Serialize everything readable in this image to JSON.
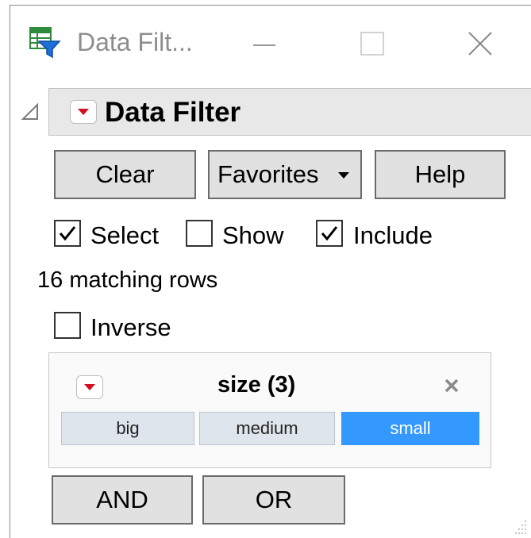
{
  "window": {
    "title": "Data Filt...",
    "controls": [
      "minimize-icon",
      "maximize-icon",
      "close-icon"
    ]
  },
  "panel": {
    "title": "Data Filter",
    "buttons": {
      "clear": "Clear",
      "favorites": "Favorites",
      "help": "Help",
      "and": "AND",
      "or": "OR"
    },
    "options": {
      "select": {
        "label": "Select",
        "checked": true
      },
      "show": {
        "label": "Show",
        "checked": false
      },
      "include": {
        "label": "Include",
        "checked": true
      },
      "inverse": {
        "label": "Inverse",
        "checked": false
      }
    },
    "status": "16 matching rows"
  },
  "filter": {
    "column": "size (3)",
    "levels": [
      {
        "label": "big",
        "selected": false
      },
      {
        "label": "medium",
        "selected": false
      },
      {
        "label": "small",
        "selected": true
      }
    ]
  },
  "colors": {
    "selected_level": "#3399ff",
    "unselected_level": "#dfe5ec",
    "menu_triangle": "#d10f1f",
    "header_bg": "#e8e8e8"
  }
}
